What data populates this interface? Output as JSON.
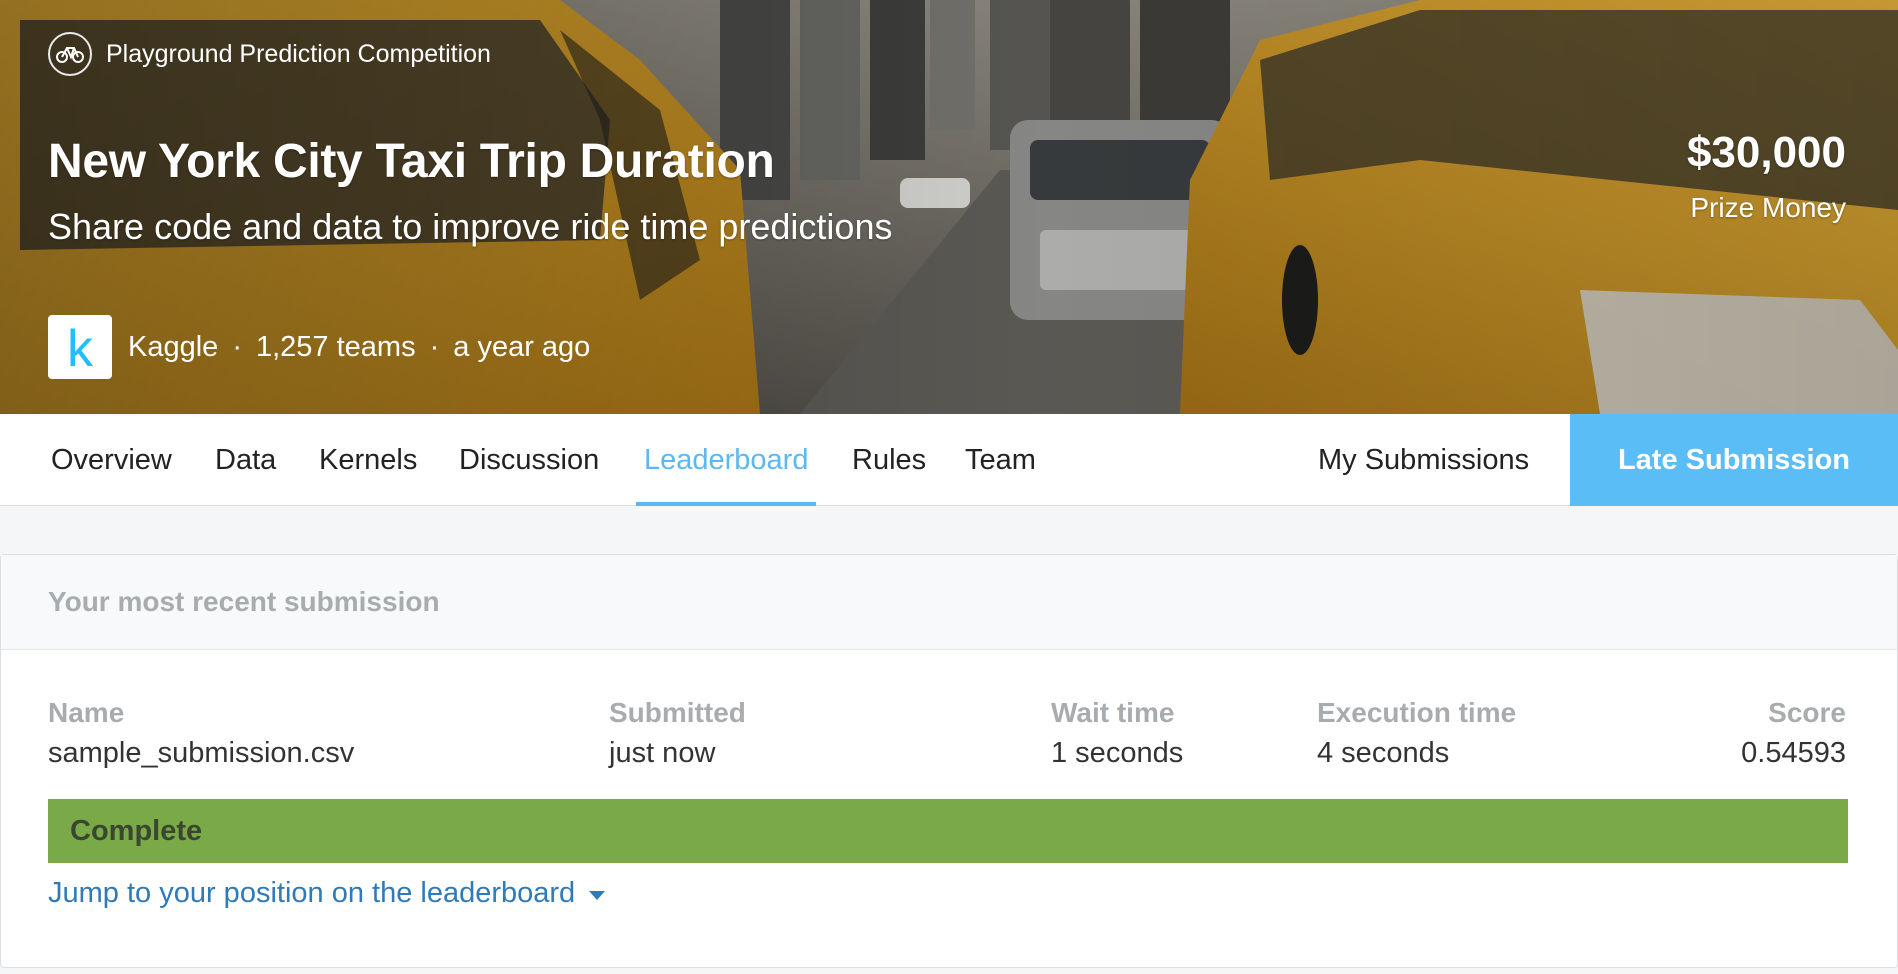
{
  "competition": {
    "type_label": "Playground Prediction Competition",
    "title": "New York City Taxi Trip Duration",
    "subtitle": "Share code and data to improve ride time predictions",
    "prize_amount": "$30,000",
    "prize_label": "Prize Money",
    "host": "Kaggle",
    "host_logo_letter": "k",
    "teams": "1,257 teams",
    "time_ago": "a year ago",
    "separator": "·"
  },
  "nav": {
    "tabs": [
      {
        "label": "Overview"
      },
      {
        "label": "Data"
      },
      {
        "label": "Kernels"
      },
      {
        "label": "Discussion"
      },
      {
        "label": "Leaderboard"
      },
      {
        "label": "Rules"
      },
      {
        "label": "Team"
      }
    ],
    "active_tab": "Leaderboard",
    "my_submissions": "My Submissions",
    "late_submission": "Late Submission"
  },
  "submission": {
    "heading": "Your most recent submission",
    "columns": {
      "name": {
        "header": "Name",
        "value": "sample_submission.csv"
      },
      "submitted": {
        "header": "Submitted",
        "value": "just now"
      },
      "wait": {
        "header": "Wait time",
        "value": "1 seconds"
      },
      "execution": {
        "header": "Execution time",
        "value": "4 seconds"
      },
      "score": {
        "header": "Score",
        "value": "0.54593"
      }
    },
    "status": "Complete",
    "jump_link": "Jump to your position on the leaderboard"
  },
  "colors": {
    "accent": "#5bbdf5",
    "complete": "#7aaa48",
    "link": "#2f7ab8",
    "taxi_yellow": "#d9a42a"
  },
  "icons": {
    "competition_type": "bicycle-icon",
    "dropdown": "caret-down-icon"
  }
}
